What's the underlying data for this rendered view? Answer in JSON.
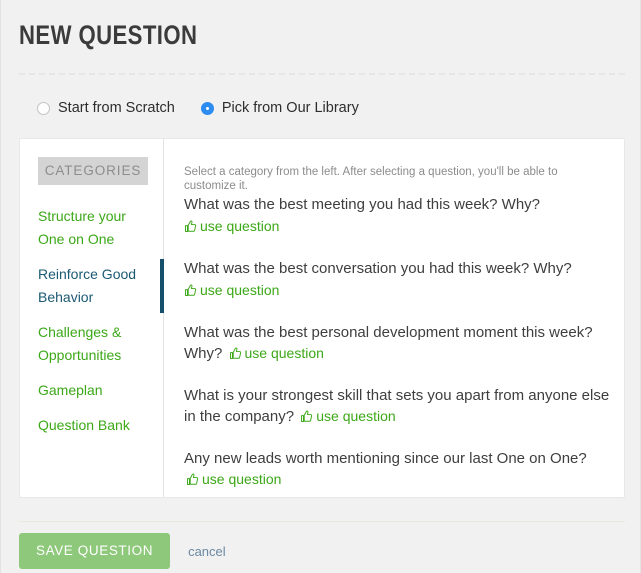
{
  "header": {
    "title": "NEW QUESTION"
  },
  "source_options": {
    "scratch": {
      "label": "Start from Scratch",
      "selected": false
    },
    "library": {
      "label": "Pick from Our Library",
      "selected": true
    }
  },
  "card": {
    "sidebar": {
      "header": "CATEGORIES",
      "items": [
        {
          "label": "Structure your One on One",
          "active": false
        },
        {
          "label": "Reinforce Good Behavior",
          "active": true
        },
        {
          "label": "Challenges & Opportunities",
          "active": false
        },
        {
          "label": "Gameplan",
          "active": false
        },
        {
          "label": "Question Bank",
          "active": false
        }
      ]
    },
    "questions_panel": {
      "help_text": "Select a category from the left. After selecting a question, you'll be able to customize it.",
      "use_question_label": "use question",
      "items": [
        {
          "text": "What was the best meeting you had this week? Why?",
          "action_on_new_line": true
        },
        {
          "text": "What was the best conversation you had this week? Why?",
          "action_on_new_line": true
        },
        {
          "text": "What was the best personal development moment this week? Why?",
          "action_on_new_line": false
        },
        {
          "text": "What is your strongest skill that sets you apart from anyone else in the company?",
          "action_on_new_line": false
        },
        {
          "text": "Any new leads worth mentioning since our last One on One?",
          "action_on_new_line": false
        }
      ]
    }
  },
  "footer": {
    "save_label": "SAVE QUESTION",
    "cancel_label": "cancel"
  },
  "colors": {
    "page_bg": "#f1f1f1",
    "card_bg": "#ffffff",
    "green_link": "#3ca818",
    "active_category": "#1b5a74",
    "active_bar": "#15506b",
    "radio_selected": "#2d8cf0",
    "save_button": "#8ec87a",
    "cancel_link": "#6b89a2",
    "categories_header_bg": "#d4d4d4"
  }
}
